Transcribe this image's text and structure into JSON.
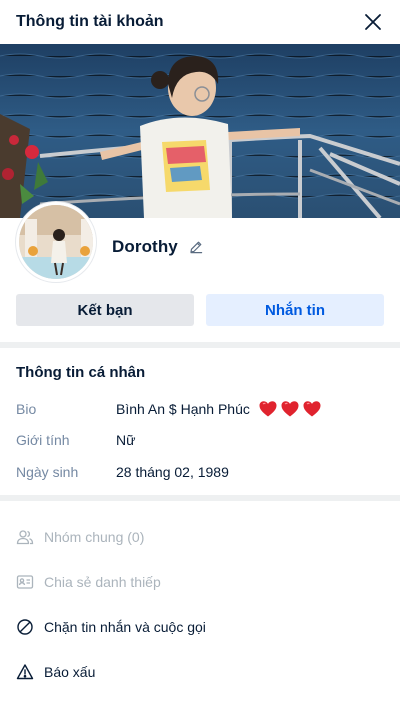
{
  "header": {
    "title": "Thông tin tài khoản",
    "close_icon": "close-icon"
  },
  "profile": {
    "display_name": "Dorothy",
    "edit_icon": "pencil-icon"
  },
  "actions": {
    "add_friend_label": "Kết bạn",
    "message_label": "Nhắn tin"
  },
  "personal_info": {
    "title": "Thông tin cá nhân",
    "rows": [
      {
        "label": "Bio",
        "value": "Bình An $ Hạnh Phúc",
        "emoji": [
          "heart",
          "heart",
          "heart"
        ]
      },
      {
        "label": "Giới tính",
        "value": "Nữ"
      },
      {
        "label": "Ngày sinh",
        "value": "28 tháng 02, 1989"
      }
    ]
  },
  "menu": {
    "items": [
      {
        "label": "Nhóm chung (0)",
        "icon": "group-icon",
        "disabled": true
      },
      {
        "label": "Chia sẻ danh thiếp",
        "icon": "contact-card-icon",
        "disabled": true
      },
      {
        "label": "Chặn tin nhắn và cuộc gọi",
        "icon": "block-icon",
        "disabled": false
      },
      {
        "label": "Báo xấu",
        "icon": "warning-icon",
        "disabled": false
      }
    ]
  },
  "colors": {
    "accent": "#005ae0",
    "accent_bg": "#e5efff",
    "text": "#081c36",
    "muted": "#7589a3",
    "disabled": "#abb4bc",
    "heart": "#e0232e"
  }
}
